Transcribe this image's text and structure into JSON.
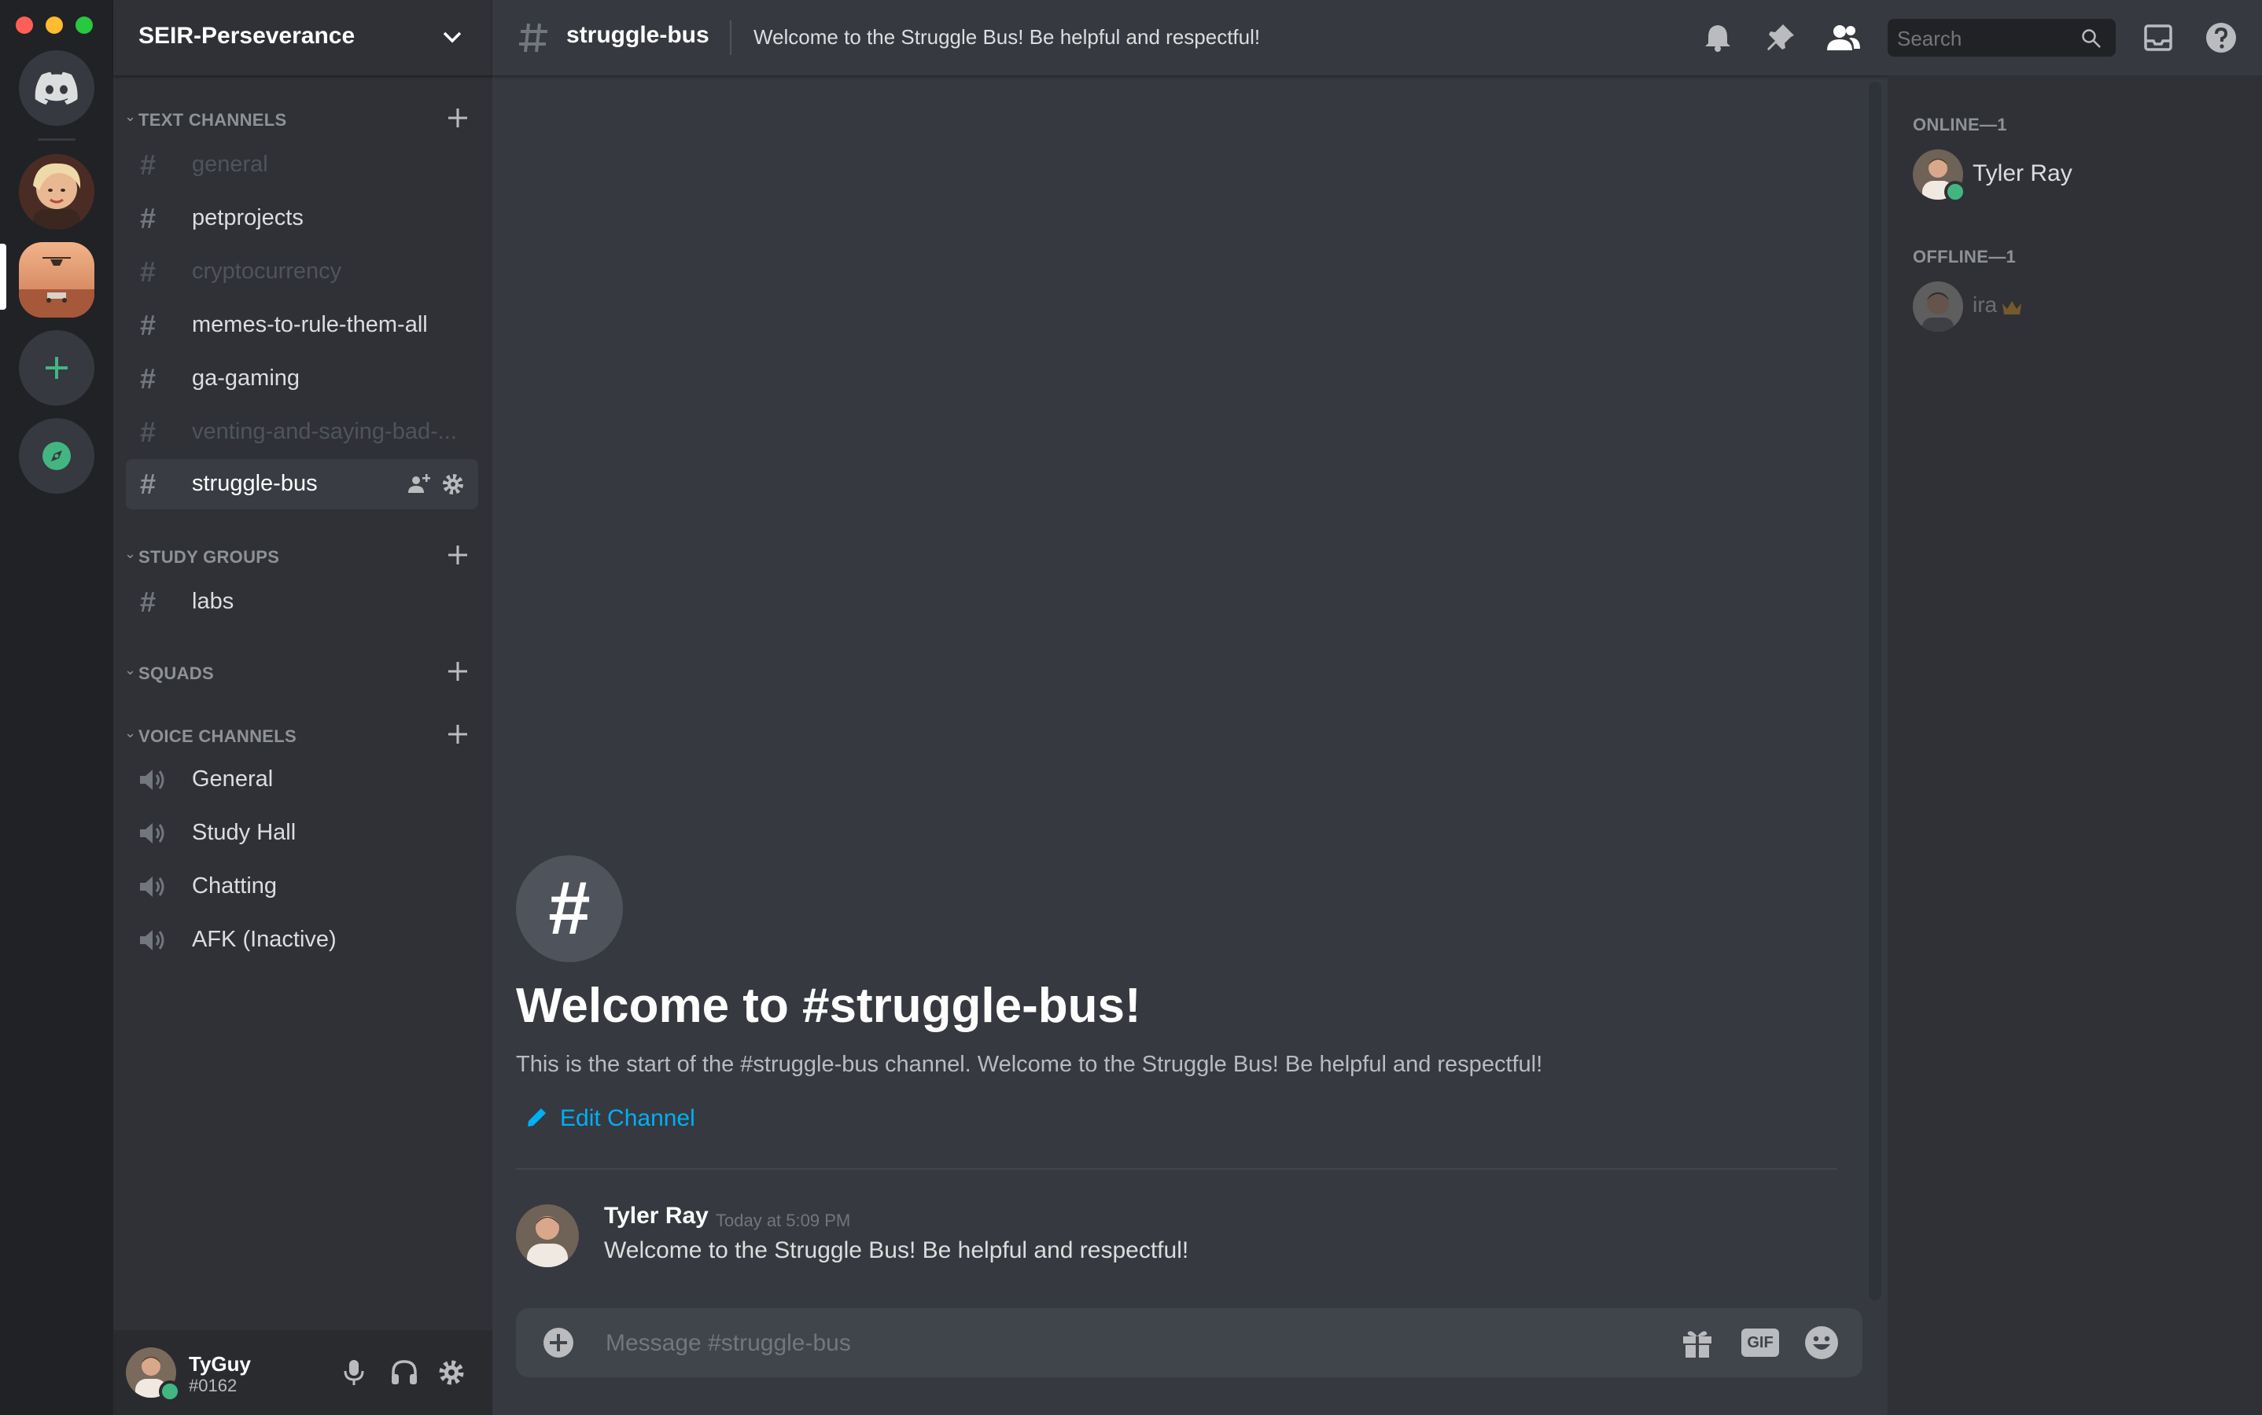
{
  "window": {
    "controls": [
      {
        "name": "close",
        "color": "#ff5f57"
      },
      {
        "name": "minimize",
        "color": "#febc2e"
      },
      {
        "name": "zoom",
        "color": "#28c840"
      }
    ]
  },
  "server_rail": {
    "items": [
      {
        "name": "home",
        "icon": "discord-logo-icon"
      },
      {
        "name": "server-portrait",
        "icon": "avatar-image"
      },
      {
        "name": "server-seir-perseverance",
        "icon": "mars-rover-image",
        "active": true
      },
      {
        "name": "add-server",
        "icon": "plus-icon"
      },
      {
        "name": "explore-servers",
        "icon": "compass-icon"
      }
    ]
  },
  "server": {
    "name": "SEIR-Perseverance"
  },
  "categories": [
    {
      "label": "TEXT CHANNELS",
      "channels": [
        {
          "name": "general",
          "state": "muted"
        },
        {
          "name": "petprojects",
          "state": "unread"
        },
        {
          "name": "cryptocurrency",
          "state": "muted"
        },
        {
          "name": "memes-to-rule-them-all",
          "state": "unread"
        },
        {
          "name": "ga-gaming",
          "state": "unread"
        },
        {
          "name": "venting-and-saying-bad-...",
          "state": "muted"
        },
        {
          "name": "struggle-bus",
          "state": "selected"
        }
      ]
    },
    {
      "label": "STUDY GROUPS",
      "channels": [
        {
          "name": "labs",
          "state": "unread"
        }
      ]
    },
    {
      "label": "SQUADS",
      "channels": []
    },
    {
      "label": "VOICE CHANNELS",
      "channels": [
        {
          "name": "General",
          "type": "voice"
        },
        {
          "name": "Study Hall",
          "type": "voice"
        },
        {
          "name": "Chatting",
          "type": "voice"
        },
        {
          "name": "AFK (Inactive)",
          "type": "voice"
        }
      ]
    }
  ],
  "user_panel": {
    "username": "TyGuy",
    "tag": "#0162",
    "status_color": "#43b581"
  },
  "header": {
    "channel_name": "struggle-bus",
    "topic": "Welcome to the Struggle Bus! Be helpful and respectful!",
    "search_placeholder": "Search"
  },
  "welcome": {
    "hash": "#",
    "title": "Welcome to #struggle-bus!",
    "subtitle": "This is the start of the #struggle-bus channel. Welcome to the Struggle Bus! Be helpful and respectful!",
    "edit_label": "Edit Channel"
  },
  "messages": [
    {
      "author": "Tyler Ray",
      "timestamp": "Today at 5:09 PM",
      "text": "Welcome to the Struggle Bus! Be helpful and respectful!"
    }
  ],
  "composer": {
    "placeholder": "Message #struggle-bus",
    "gif_label": "GIF"
  },
  "members": {
    "online_label": "ONLINE—1",
    "offline_label": "OFFLINE—1",
    "online": [
      {
        "name": "Tyler Ray"
      }
    ],
    "offline": [
      {
        "name": "ira",
        "owner": true
      }
    ]
  },
  "colors": {
    "accent": "#5865f2",
    "online": "#43b581",
    "link": "#00b0f4",
    "owner_crown": "#faa81a"
  }
}
